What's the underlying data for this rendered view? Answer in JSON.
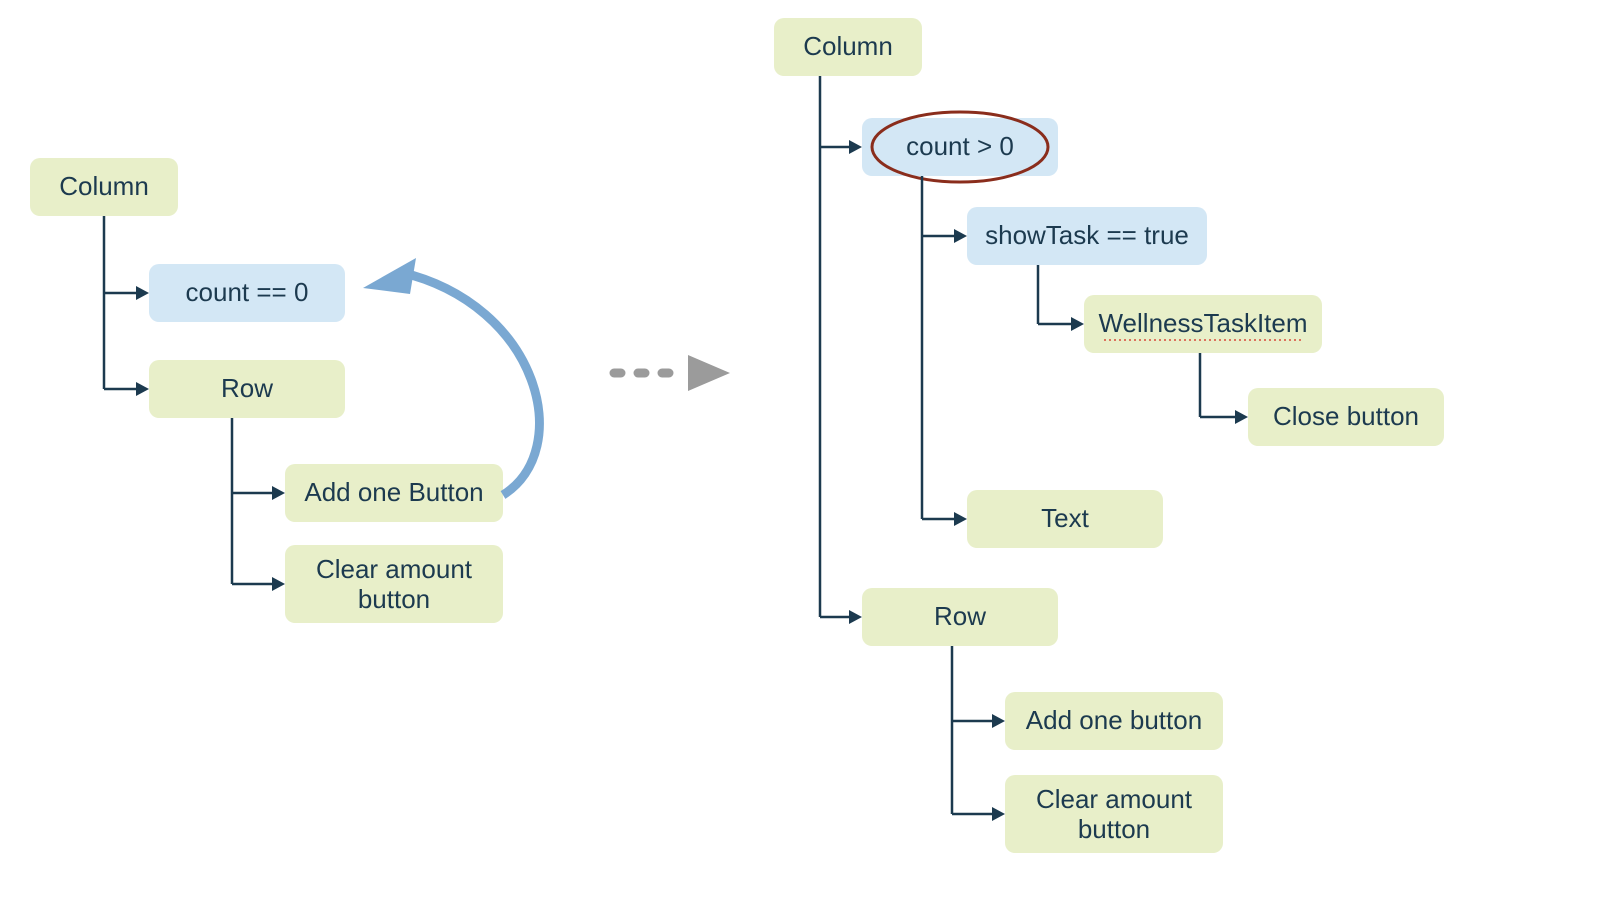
{
  "left_tree": {
    "column": "Column",
    "count_eq_zero": "count == 0",
    "row": "Row",
    "add_one": "Add one Button",
    "clear_amount_l1": "Clear amount",
    "clear_amount_l2": "button"
  },
  "right_tree": {
    "column": "Column",
    "count_gt_zero": "count > 0",
    "show_task": "showTask == true",
    "wellness": "WellnessTaskItem",
    "close_button": "Close button",
    "text": "Text",
    "row": "Row",
    "add_one": "Add one button",
    "clear_amount_l1": "Clear amount",
    "clear_amount_l2": "button"
  }
}
